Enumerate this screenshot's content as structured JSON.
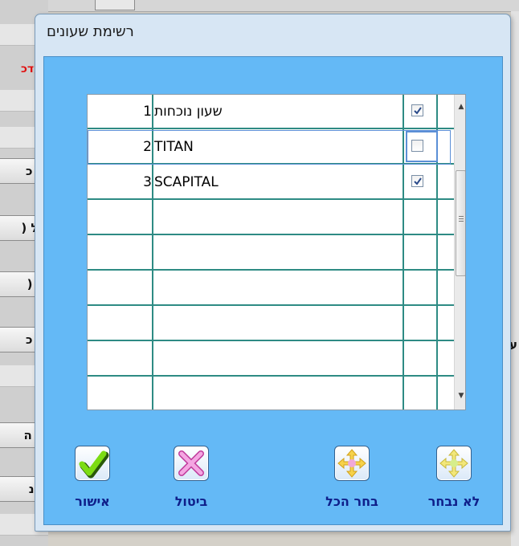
{
  "background": {
    "red_label": "עדכ",
    "buttons": [
      "ת כ",
      "כל (",
      "ת (",
      "ת כ",
      "א ה",
      "לינ"
    ],
    "right_text": "ע"
  },
  "dialog": {
    "title": "רשימת שעונים",
    "rows": [
      {
        "num": "1",
        "name": "שעון נוכחות",
        "checked": true
      },
      {
        "num": "2",
        "name": "TITAN",
        "checked": false
      },
      {
        "num": "3",
        "name": "SCAPITAL",
        "checked": true
      }
    ],
    "buttons": {
      "ok": "אישור",
      "cancel": "ביטול",
      "select_all": "בחר הכל",
      "select_none": "לא נבחר"
    }
  },
  "colors": {
    "client_bg": "#64b9f6",
    "grid_line": "#2e8b84",
    "button_label": "#0f1f8a"
  }
}
